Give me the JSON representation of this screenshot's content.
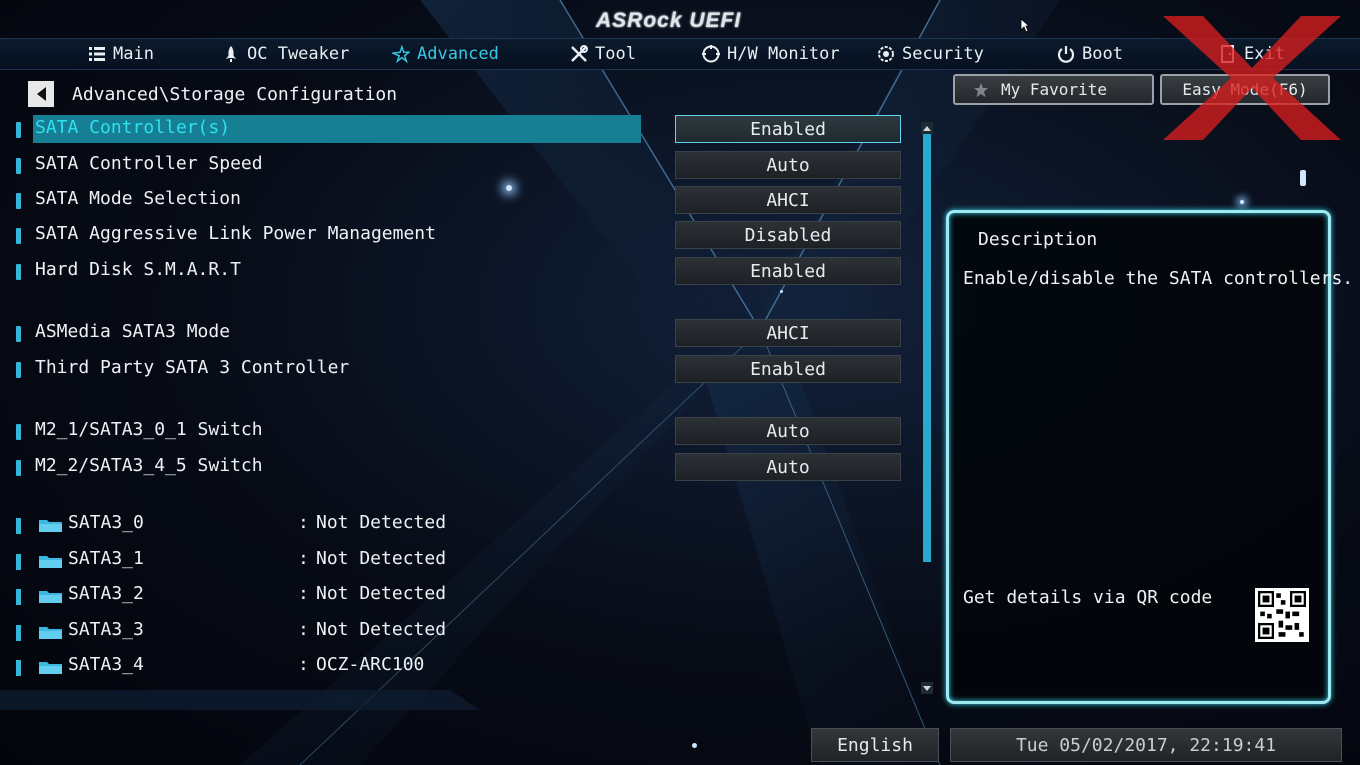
{
  "app": {
    "logo": "ASRock UEFI"
  },
  "tabs": [
    {
      "label": "Main",
      "icon": "list-icon",
      "active": false
    },
    {
      "label": "OC Tweaker",
      "icon": "rocket-icon",
      "active": false
    },
    {
      "label": "Advanced",
      "icon": "star-icon",
      "active": true
    },
    {
      "label": "Tool",
      "icon": "wrench-icon",
      "active": false
    },
    {
      "label": "H/W Monitor",
      "icon": "monitor-icon",
      "active": false
    },
    {
      "label": "Security",
      "icon": "shield-icon",
      "active": false
    },
    {
      "label": "Boot",
      "icon": "power-icon",
      "active": false
    },
    {
      "label": "Exit",
      "icon": "exit-icon",
      "active": false
    }
  ],
  "breadcrumb": "Advanced\\Storage Configuration",
  "settings": [
    {
      "label": "SATA Controller(s)",
      "value": "Enabled",
      "selected": true
    },
    {
      "label": "SATA Controller Speed",
      "value": "Auto"
    },
    {
      "label": "SATA Mode Selection",
      "value": "AHCI"
    },
    {
      "label": "SATA Aggressive Link Power Management",
      "value": "Disabled"
    },
    {
      "label": "Hard Disk S.M.A.R.T",
      "value": "Enabled"
    },
    {
      "label": "ASMedia SATA3 Mode",
      "value": "AHCI"
    },
    {
      "label": "Third Party SATA 3 Controller",
      "value": "Enabled"
    },
    {
      "label": "M2_1/SATA3_0_1 Switch",
      "value": "Auto"
    },
    {
      "label": "M2_2/SATA3_4_5 Switch",
      "value": "Auto"
    }
  ],
  "devices": [
    {
      "port": "SATA3_0",
      "status": "Not Detected"
    },
    {
      "port": "SATA3_1",
      "status": "Not Detected"
    },
    {
      "port": "SATA3_2",
      "status": "Not Detected"
    },
    {
      "port": "SATA3_3",
      "status": "Not Detected"
    },
    {
      "port": "SATA3_4",
      "status": "OCZ-ARC100"
    }
  ],
  "buttons": {
    "favorite": "My Favorite",
    "easy_mode": "Easy Mode(F6)"
  },
  "description": {
    "title": "Description",
    "text": "Enable/disable the SATA controllers.",
    "qr_text": "Get details via QR code"
  },
  "footer": {
    "language": "English",
    "datetime": "Tue 05/02/2017, 22:19:41"
  },
  "colors": {
    "accent": "#38c8e6",
    "highlight": "#167f93",
    "watermark": "#d81f1f"
  }
}
